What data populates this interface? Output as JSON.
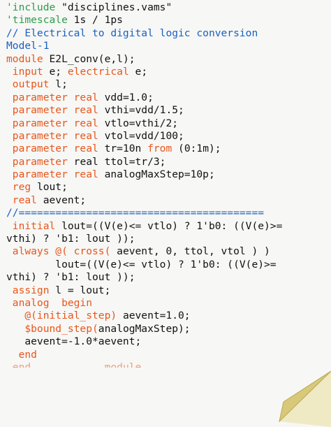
{
  "lines": [
    [
      [
        "'include ",
        "green"
      ],
      [
        "\"disciplines.vams\"",
        "dark"
      ]
    ],
    [
      [
        "'timescale ",
        "green"
      ],
      [
        "1s / 1ps",
        "dark"
      ]
    ],
    [
      [
        "// Electrical to digital logic conversion",
        "blue"
      ]
    ],
    [
      [
        "Model-1",
        "blue"
      ]
    ],
    [
      [
        "module ",
        "orange"
      ],
      [
        "E2L_conv(e,l);",
        "dark"
      ]
    ],
    [
      [
        " input ",
        "orange"
      ],
      [
        "e; ",
        "dark"
      ],
      [
        "electrical ",
        "orange"
      ],
      [
        "e;",
        "dark"
      ]
    ],
    [
      [
        " output ",
        "orange"
      ],
      [
        "l;",
        "dark"
      ]
    ],
    [
      [
        " parameter real ",
        "orange"
      ],
      [
        "vdd=1.0;",
        "dark"
      ]
    ],
    [
      [
        " parameter real ",
        "orange"
      ],
      [
        "vthi=vdd/1.5;",
        "dark"
      ]
    ],
    [
      [
        " parameter real ",
        "orange"
      ],
      [
        "vtlo=vthi/2;",
        "dark"
      ]
    ],
    [
      [
        " parameter real ",
        "orange"
      ],
      [
        "vtol=vdd/100;",
        "dark"
      ]
    ],
    [
      [
        " parameter real ",
        "orange"
      ],
      [
        "tr=10n ",
        "dark"
      ],
      [
        "from ",
        "orange"
      ],
      [
        "(0:1m);",
        "dark"
      ]
    ],
    [
      [
        " parameter ",
        "orange"
      ],
      [
        "real ttol=tr/3;",
        "dark"
      ]
    ],
    [
      [
        " parameter real ",
        "orange"
      ],
      [
        "analogMaxStep=10p;",
        "dark"
      ]
    ],
    [
      [
        " reg ",
        "orange"
      ],
      [
        "lout;",
        "dark"
      ]
    ],
    [
      [
        " real ",
        "orange"
      ],
      [
        "aevent;",
        "dark"
      ]
    ],
    [
      [
        "//========================================",
        "blue"
      ]
    ],
    [
      [
        " initial ",
        "orange"
      ],
      [
        "lout=((V(e)<= vtlo) ? 1'b0: ((V(e)>=",
        "dark"
      ]
    ],
    [
      [
        "vthi) ? 'b1: lout ));",
        "dark"
      ]
    ],
    [
      [
        " always @( cross( ",
        "orange"
      ],
      [
        "aevent, 0, ttol, vtol ) )",
        "dark"
      ]
    ],
    [
      [
        "        lout=((V(e)<= vtlo) ? 1'b0: ((V(e)>=",
        "dark"
      ]
    ],
    [
      [
        "vthi) ? 'b1: lout ));",
        "dark"
      ]
    ],
    [
      [
        " assign ",
        "orange"
      ],
      [
        "l = lout;",
        "dark"
      ]
    ],
    [
      [
        " analog  begin",
        "orange"
      ]
    ],
    [
      [
        "   @(initial_step) ",
        "orange"
      ],
      [
        "aevent=1.0;",
        "dark"
      ]
    ],
    [
      [
        "   $bound_step(",
        "orange"
      ],
      [
        "analogMaxStep);",
        "dark"
      ]
    ],
    [
      [
        "   aevent=-1.0*aevent;",
        "dark"
      ]
    ],
    [
      [
        "  end",
        "orange"
      ]
    ]
  ],
  "truncated_line": " end\t\tmodule",
  "colors": {
    "orange": "#e8561c",
    "blue": "#1a5fc4",
    "green": "#2c9c4b",
    "dark": "#111111",
    "fold_fill": "#d8c97a",
    "fold_edge": "#b9a84e"
  },
  "icons": {
    "page_curl": "page-curl-icon"
  }
}
